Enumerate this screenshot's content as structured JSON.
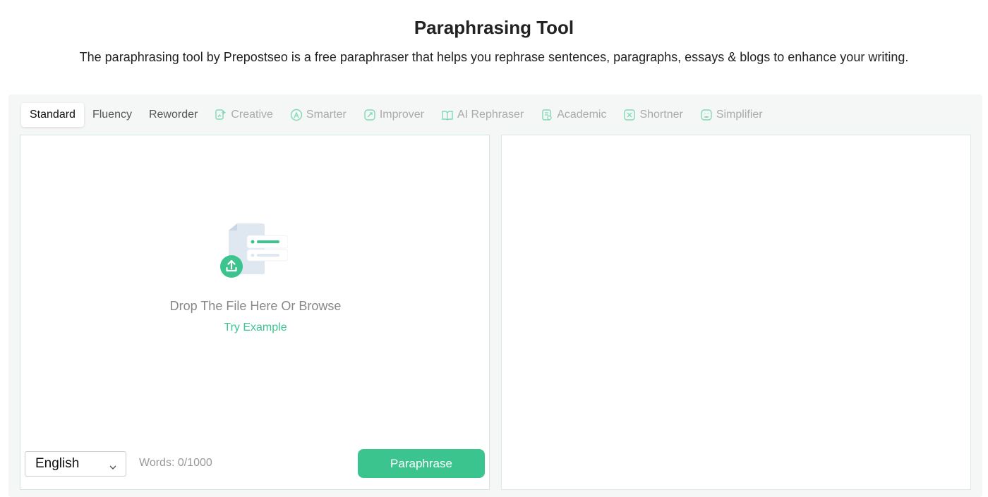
{
  "header": {
    "title": "Paraphrasing Tool",
    "subtitle": "The paraphrasing tool by Prepostseo is a free paraphraser that helps you rephrase sentences, paragraphs, essays & blogs to enhance your writing."
  },
  "modes": [
    {
      "label": "Standard",
      "icon": "",
      "state": "active"
    },
    {
      "label": "Fluency",
      "icon": "",
      "state": "free"
    },
    {
      "label": "Reworder",
      "icon": "",
      "state": "free"
    },
    {
      "label": "Creative",
      "icon": "creative-icon",
      "state": "premium"
    },
    {
      "label": "Smarter",
      "icon": "smarter-icon",
      "state": "premium"
    },
    {
      "label": "Improver",
      "icon": "improver-icon",
      "state": "premium"
    },
    {
      "label": "AI Rephraser",
      "icon": "ai-rephraser-icon",
      "state": "premium"
    },
    {
      "label": "Academic",
      "icon": "academic-icon",
      "state": "premium"
    },
    {
      "label": "Shortner",
      "icon": "shortner-icon",
      "state": "premium"
    },
    {
      "label": "Simplifier",
      "icon": "simplifier-icon",
      "state": "premium"
    }
  ],
  "input": {
    "drop_text": "Drop The File Here Or Browse",
    "try_example": "Try Example",
    "language": "English",
    "word_count": "Words: 0/1000",
    "paraphrase_label": "Paraphrase"
  },
  "colors": {
    "accent": "#3cc48f",
    "panel_bg": "#f5f6f6",
    "premium_icon": "#7fd9b5"
  }
}
